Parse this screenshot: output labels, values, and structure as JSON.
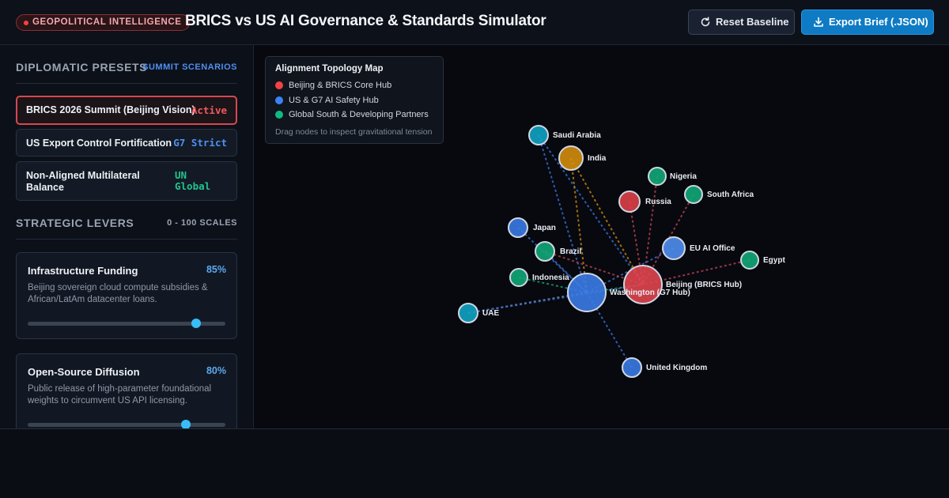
{
  "header": {
    "badge": "GEOPOLITICAL INTELLIGENCE",
    "title": "BRICS vs US AI Governance & Standards Simulator",
    "reset_label": "Reset Baseline",
    "export_label": "Export Brief (.JSON)"
  },
  "presets": {
    "title": "DIPLOMATIC PRESETS",
    "aside": "SUMMIT SCENARIOS",
    "items": [
      {
        "label": "BRICS 2026 Summit (Beijing Vision)",
        "tag": "Active",
        "tag_color": "#ef5a5f",
        "active": true
      },
      {
        "label": "US Export Control Fortification",
        "tag": "G7 Strict",
        "tag_color": "#4f8ff0",
        "active": false
      },
      {
        "label_line1": "Non-Aligned Multilateral",
        "label_line2": "Balance",
        "tag_line1": "UN",
        "tag_line2": "Global",
        "tag_color": "#22c38e",
        "active": false
      }
    ]
  },
  "levers": {
    "title": "STRATEGIC LEVERS",
    "aside": "0 - 100 SCALES",
    "items": [
      {
        "name": "Infrastructure Funding",
        "value_label": "85%",
        "value": 85,
        "desc_line1": "Beijing sovereign cloud compute subsidies &",
        "desc_line2": "African/LatAm datacenter loans."
      },
      {
        "name": "Open-Source Diffusion",
        "value_label": "80%",
        "value": 80,
        "desc_line1": "Public release of high-parameter foundational",
        "desc_line2": "weights to circumvent US API licensing."
      }
    ]
  },
  "legend": {
    "title": "Alignment Topology Map",
    "items": [
      {
        "label": "Beijing & BRICS Core Hub",
        "color": "#ef4444"
      },
      {
        "label": "US & G7 AI Safety Hub",
        "color": "#3b82f6"
      },
      {
        "label": "Global South & Developing Partners",
        "color": "#10b981"
      }
    ],
    "hint": "Drag nodes to inspect gravitational tension"
  },
  "graph": {
    "nodes": [
      {
        "id": "washington",
        "label": "Washington (G7 Hub)",
        "color": "#3b7be6"
      },
      {
        "id": "beijing",
        "label": "Beijing (BRICS Hub)",
        "color": "#e0454f"
      },
      {
        "id": "saudi",
        "label": "Saudi Arabia",
        "color": "#0fa3c2"
      },
      {
        "id": "india",
        "label": "India",
        "color": "#d48d0c"
      },
      {
        "id": "nigeria",
        "label": "Nigeria",
        "color": "#12a878"
      },
      {
        "id": "southafrica",
        "label": "South Africa",
        "color": "#12a878"
      },
      {
        "id": "russia",
        "label": "Russia",
        "color": "#dd4048"
      },
      {
        "id": "japan",
        "label": "Japan",
        "color": "#3a7be6"
      },
      {
        "id": "euai",
        "label": "EU AI Office",
        "color": "#4f8ef0"
      },
      {
        "id": "brazil",
        "label": "Brazil",
        "color": "#12a878"
      },
      {
        "id": "egypt",
        "label": "Egypt",
        "color": "#12a878"
      },
      {
        "id": "indonesia",
        "label": "Indonesia",
        "color": "#12a878"
      },
      {
        "id": "uae",
        "label": "UAE",
        "color": "#0fa3c2"
      },
      {
        "id": "uk",
        "label": "United Kingdom",
        "color": "#3a7be6"
      }
    ]
  }
}
